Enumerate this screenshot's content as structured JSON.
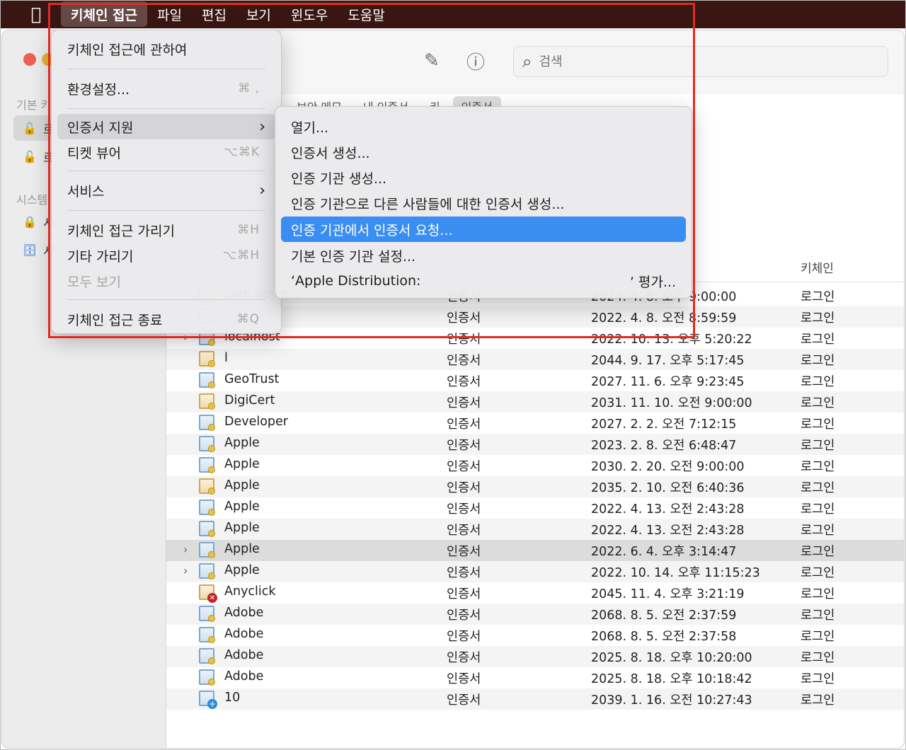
{
  "menubar": {
    "apple_icon": "apple-logo-icon",
    "items": [
      "키체인 접근",
      "파일",
      "편집",
      "보기",
      "윈도우",
      "도움말"
    ]
  },
  "sidebar": {
    "section1": "기본 키",
    "item1": "로",
    "item2": "로",
    "section2": "시스템",
    "item3": "시",
    "item4": "시"
  },
  "toolbar": {
    "search_placeholder": "검색"
  },
  "tabs": [
    "보안 메모",
    "내 인증서",
    "키",
    "인증서"
  ],
  "table": {
    "header_keychain": "키체인",
    "rows": [
      {
        "name": "com.apple...",
        "kind": "인증서",
        "expires": "2024. 4. 8. 오후 9:00:00",
        "keychain": "로그인"
      },
      {
        "name": "",
        "kind": "인증서",
        "expires": "2022. 4. 8. 오전 8:59:59",
        "keychain": "로그인"
      },
      {
        "name": "localhost",
        "kind": "인증서",
        "expires": "2022. 10. 13. 오후 5:20:22",
        "keychain": "로그인"
      },
      {
        "name": "l",
        "kind": "인증서",
        "expires": "2044. 9. 17. 오후 5:17:45",
        "keychain": "로그인"
      },
      {
        "name": "GeoTrust",
        "kind": "인증서",
        "expires": "2027. 11. 6. 오후 9:23:45",
        "keychain": "로그인"
      },
      {
        "name": "DigiCert",
        "kind": "인증서",
        "expires": "2031. 11. 10. 오전 9:00:00",
        "keychain": "로그인"
      },
      {
        "name": "Developer",
        "kind": "인증서",
        "expires": "2027. 2. 2. 오전 7:12:15",
        "keychain": "로그인"
      },
      {
        "name": "Apple",
        "kind": "인증서",
        "expires": "2023. 2. 8. 오전 6:48:47",
        "keychain": "로그인"
      },
      {
        "name": "Apple",
        "kind": "인증서",
        "expires": "2030. 2. 20. 오전 9:00:00",
        "keychain": "로그인"
      },
      {
        "name": "Apple",
        "kind": "인증서",
        "expires": "2035. 2. 10. 오전 6:40:36",
        "keychain": "로그인"
      },
      {
        "name": "Apple",
        "kind": "인증서",
        "expires": "2022. 4. 13. 오전 2:43:28",
        "keychain": "로그인"
      },
      {
        "name": "Apple",
        "kind": "인증서",
        "expires": "2022. 4. 13. 오전 2:43:28",
        "keychain": "로그인"
      },
      {
        "name": "Apple",
        "kind": "인증서",
        "expires": "2022. 6. 4. 오후 3:14:47",
        "keychain": "로그인"
      },
      {
        "name": "Apple",
        "kind": "인증서",
        "expires": "2022. 10. 14. 오후 11:15:23",
        "keychain": "로그인"
      },
      {
        "name": "Anyclick",
        "kind": "인증서",
        "expires": "2045. 11. 4. 오후 3:21:19",
        "keychain": "로그인"
      },
      {
        "name": "Adobe",
        "kind": "인증서",
        "expires": "2068. 8. 5. 오전 2:37:59",
        "keychain": "로그인"
      },
      {
        "name": "Adobe",
        "kind": "인증서",
        "expires": "2068. 8. 5. 오전 2:37:58",
        "keychain": "로그인"
      },
      {
        "name": "Adobe",
        "kind": "인증서",
        "expires": "2025. 8. 18. 오후 10:20:00",
        "keychain": "로그인"
      },
      {
        "name": "Adobe",
        "kind": "인증서",
        "expires": "2025. 8. 18. 오후 10:18:42",
        "keychain": "로그인"
      },
      {
        "name": "10",
        "kind": "인증서",
        "expires": "2039. 1. 16. 오전 10:27:43",
        "keychain": "로그인"
      }
    ]
  },
  "main_menu": {
    "about": "키체인 접근에 관하여",
    "preferences": "환경설정...",
    "preferences_sc": "⌘ ,",
    "cert_assistant": "인증서 지원",
    "ticket_viewer": "티켓 뷰어",
    "ticket_viewer_sc": "⌥⌘K",
    "services": "서비스",
    "hide": "키체인 접근 가리기",
    "hide_sc": "⌘H",
    "hide_others": "기타 가리기",
    "hide_others_sc": "⌥⌘H",
    "show_all": "모두 보기",
    "quit": "키체인 접근 종료",
    "quit_sc": "⌘Q"
  },
  "submenu": {
    "open": "열기...",
    "create_cert": "인증서 생성...",
    "create_ca": "인증 기관 생성...",
    "create_for_others": "인증 기관으로 다른 사람들에 대한 인증서 생성...",
    "request_from_ca": "인증 기관에서 인증서 요청...",
    "set_default_ca": "기본 인증 기관 설정...",
    "evaluate_left": "‘Apple Distribution:",
    "evaluate_right": "’ 평가..."
  },
  "colors": {
    "menubar_bg": "#3a1612",
    "highlight": "#3a8ef2",
    "annotation_red": "#e4291f"
  }
}
